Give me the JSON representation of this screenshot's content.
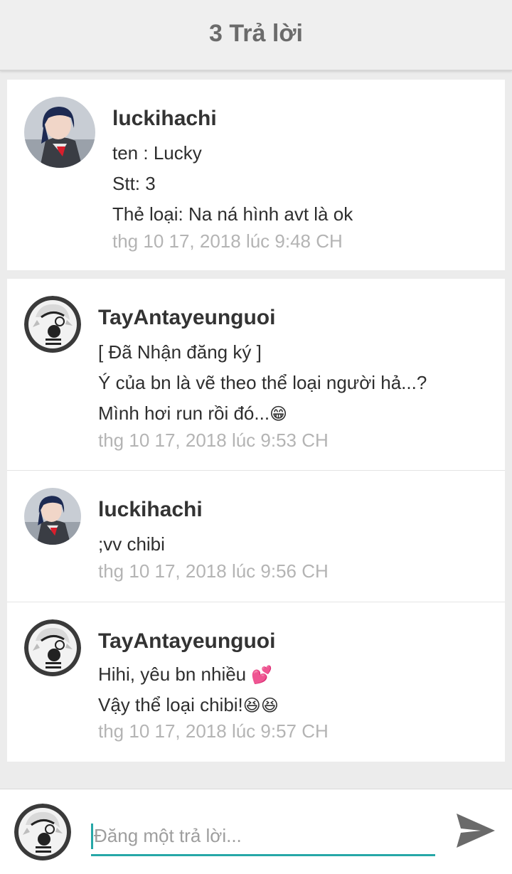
{
  "header": {
    "title": "3 Trả lời"
  },
  "main_comment": {
    "username": "luckihachi",
    "lines": [
      "ten : Lucky",
      "Stt: 3",
      "Thẻ loại: Na ná hình avt là ok"
    ],
    "time": "thg 10 17, 2018 lúc 9:48 CH"
  },
  "replies": [
    {
      "username": "TayAntayeunguoi",
      "lines": [
        "[ Đã Nhận đăng ký ]",
        "Ý của bn là vẽ theo thể loại người hả...?",
        "Mình hơi run rồi đó..."
      ],
      "emoji": [
        "😁"
      ],
      "time": "thg 10 17, 2018 lúc 9:53 CH"
    },
    {
      "username": "luckihachi",
      "lines": [
        ";vv chibi"
      ],
      "time": "thg 10 17, 2018 lúc 9:56 CH"
    },
    {
      "username": "TayAntayeunguoi",
      "lines": [
        "Hihi, yêu bn nhiều ",
        "Vậy thể loại chibi!"
      ],
      "emoji": [
        "💕",
        "😆😆"
      ],
      "time": "thg 10 17, 2018 lúc 9:57 CH"
    }
  ],
  "reply_bar": {
    "placeholder": "Đăng một trả lời..."
  },
  "icons": {
    "send": "send-icon",
    "avatar_luckihachi": "avatar-cosplay-girl",
    "avatar_tayan": "avatar-headphones-chibi"
  },
  "colors": {
    "accent": "#26a7a7",
    "time": "#b4b4b4",
    "header_bg": "#efefef",
    "send_icon": "#6a6a6a"
  }
}
